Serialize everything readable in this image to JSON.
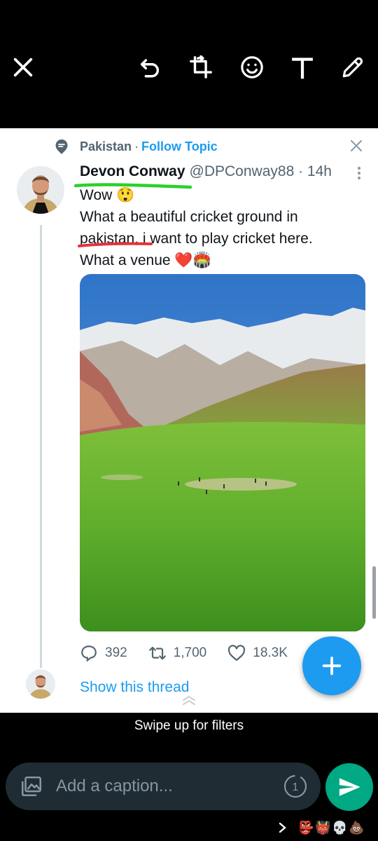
{
  "toolbar": {
    "items": [
      "close",
      "undo",
      "crop-rotate",
      "sticker",
      "text",
      "draw"
    ]
  },
  "tweet": {
    "topic": "Pakistan",
    "topic_separator": "·",
    "follow_topic": "Follow Topic",
    "author_name": "Devon Conway",
    "author_meta": "@DPConway88 · 14h",
    "text_lines": [
      "Wow 😲",
      "What a beautiful cricket ground in",
      "pakistan, i want to play cricket here.",
      "What a venue ❤️🏟️"
    ],
    "replies": "392",
    "retweets": "1,700",
    "likes": "18.3K",
    "show_thread": "Show this thread"
  },
  "colors": {
    "link_blue": "#1d9bf0",
    "green_mark": "#2bd12b",
    "red_mark": "#e8303a",
    "send_green": "#00a884"
  },
  "footer": {
    "swipe_hint": "Swipe up for filters",
    "caption_placeholder": "Add a caption...",
    "view_once_number": "1",
    "recipient_emojis": [
      "👺",
      "👹",
      "💀",
      "💩"
    ]
  }
}
